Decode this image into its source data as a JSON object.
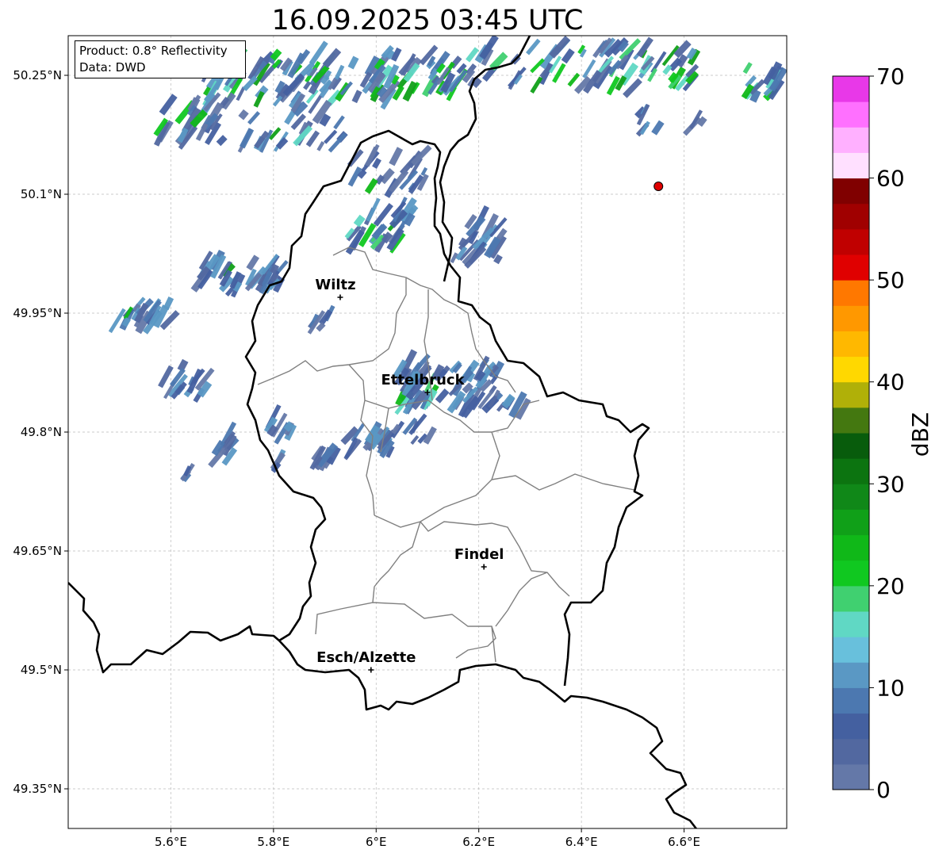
{
  "title": "16.09.2025 03:45 UTC",
  "info_box": {
    "product": "Product: 0.8° Reflectivity",
    "data": "Data: DWD"
  },
  "map": {
    "lon_range": [
      5.4,
      6.8
    ],
    "lat_range": [
      49.3,
      50.3
    ],
    "x_ticks": [
      "5.6°E",
      "5.8°E",
      "6°E",
      "6.2°E",
      "6.4°E",
      "6.6°E"
    ],
    "y_ticks": [
      "50.25°N",
      "50.1°N",
      "49.95°N",
      "49.8°N",
      "49.65°N",
      "49.5°N",
      "49.35°N"
    ],
    "gridlines": true,
    "cities": [
      {
        "name": "Wiltz",
        "lon": 5.93,
        "lat": 49.97
      },
      {
        "name": "Ettelbruck",
        "lon": 6.1,
        "lat": 49.85
      },
      {
        "name": "Findel",
        "lon": 6.21,
        "lat": 49.63
      },
      {
        "name": "Esch/Alzette",
        "lon": 5.99,
        "lat": 49.5
      }
    ],
    "radar_site": {
      "lon": 6.55,
      "lat": 50.11,
      "color": "#e00000"
    }
  },
  "colorbar": {
    "label": "dBZ",
    "min": 0,
    "max": 70,
    "step": 2.5,
    "tick_labels": [
      "0",
      "10",
      "20",
      "30",
      "40",
      "50",
      "60",
      "70"
    ],
    "colors": [
      "#6478a8",
      "#5268a0",
      "#4460a0",
      "#4c78b0",
      "#5a98c4",
      "#68c0dc",
      "#60d8c4",
      "#40d070",
      "#10c820",
      "#10b818",
      "#10a018",
      "#108818",
      "#0c7410",
      "#085c0c",
      "#447810",
      "#b0b008",
      "#ffd800",
      "#ffb800",
      "#ff9800",
      "#ff7800",
      "#e00000",
      "#c00000",
      "#a00000",
      "#800000",
      "#ffe0ff",
      "#ffb0ff",
      "#ff70ff",
      "#e838e8"
    ]
  },
  "legend_colors": {
    "country_border": "#000000",
    "canton_border": "#808080",
    "grid": "#bbbbbb"
  }
}
